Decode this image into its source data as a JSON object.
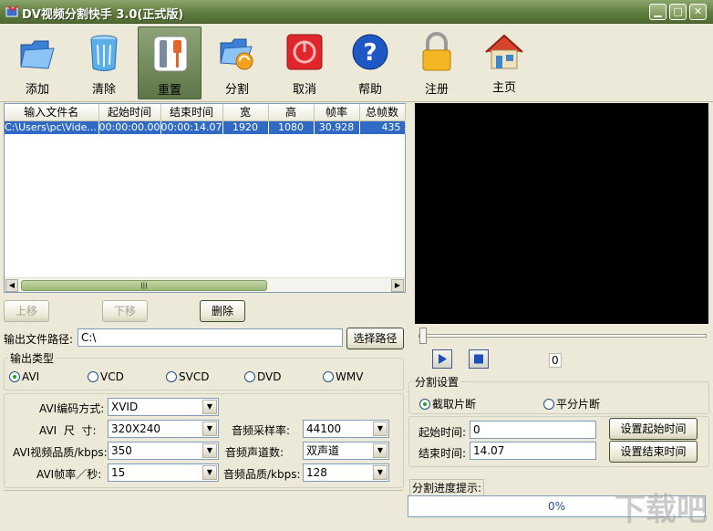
{
  "window": {
    "title": "DV视频分割快手 3.0(正式版)",
    "min": "▁",
    "max": "□",
    "close": "✕"
  },
  "toolbar": [
    {
      "label": "添加",
      "icon": "folder-icon"
    },
    {
      "label": "清除",
      "icon": "recycle-bin-icon"
    },
    {
      "label": "重置",
      "icon": "tools-icon"
    },
    {
      "label": "分割",
      "icon": "split-folder-icon"
    },
    {
      "label": "取消",
      "icon": "cancel-icon"
    },
    {
      "label": "帮助",
      "icon": "help-icon"
    },
    {
      "label": "注册",
      "icon": "lock-icon"
    },
    {
      "label": "主页",
      "icon": "home-icon"
    }
  ],
  "filelist": {
    "columns": [
      "输入文件名",
      "起始时间",
      "结束时间",
      "宽",
      "高",
      "帧率",
      "总帧数"
    ],
    "rows": [
      [
        "C:\\Users\\pc\\Vide...",
        "00:00:00.00",
        "00:00:14.07",
        "1920",
        "1080",
        "30.928",
        "435"
      ]
    ],
    "scroll_thumb": "|||"
  },
  "buttons": {
    "up": "上移",
    "down": "下移",
    "delete": "删除",
    "choose_path": "选择路径"
  },
  "output": {
    "path_label": "输出文件路径:",
    "path_value": "C:\\"
  },
  "output_type": {
    "legend": "输出类型",
    "options": [
      "AVI",
      "VCD",
      "SVCD",
      "DVD",
      "WMV"
    ],
    "selected": "AVI"
  },
  "settings": {
    "codec_label": "AVI编码方式:",
    "codec": "XVID",
    "size_label": "AVI  尺  寸:",
    "size": "320X240",
    "quality_label": "AVI视频品质/kbps:",
    "quality": "350",
    "fps_label": "AVI帧率／秒:",
    "fps": "15",
    "samplerate_label": "音频采样率:",
    "samplerate": "44100",
    "channels_label": "音频声道数:",
    "channels": "双声道",
    "audio_quality_label": "音频品质/kbps:",
    "audio_quality": "128"
  },
  "player": {
    "frame": "0",
    "position": 0.0
  },
  "split": {
    "legend": "分割设置",
    "mode_clip": "截取片断",
    "mode_even": "平分片断",
    "start_label": "起始时间:",
    "start_value": "0",
    "end_label": "结束时间:",
    "end_value": "14.07",
    "set_start": "设置起始时间",
    "set_end": "设置结束时间"
  },
  "progress": {
    "label": "分割进度提示:",
    "text": "0%",
    "fraction": 0.0
  },
  "watermark": "下载吧",
  "colors": {
    "title_bar": "#5f7d3e",
    "selection": "#316ac5",
    "video_bg": "#000000"
  }
}
